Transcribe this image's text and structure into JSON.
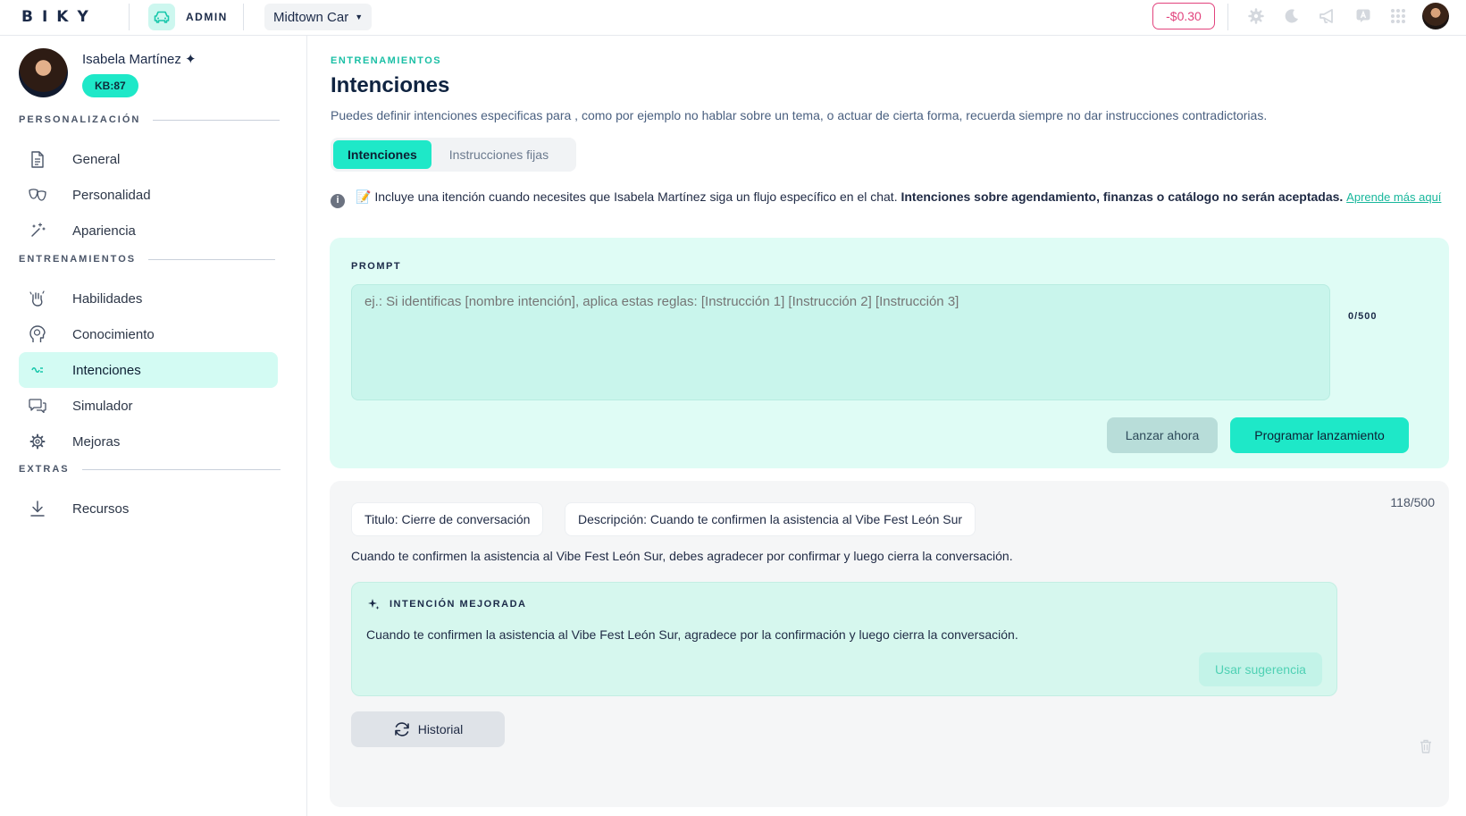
{
  "topbar": {
    "logo": "BIKY",
    "admin_label": "ADMIN",
    "company": "Midtown Car",
    "balance": "-$0.30"
  },
  "profile": {
    "name": "Isabela Martínez ✦",
    "kb_badge": "KB:87"
  },
  "sidebar": {
    "sections": [
      {
        "label": "PERSONALIZACIÓN"
      },
      {
        "label": "ENTRENAMIENTOS"
      },
      {
        "label": "EXTRAS"
      }
    ],
    "items": [
      {
        "label": "General"
      },
      {
        "label": "Personalidad"
      },
      {
        "label": "Apariencia"
      },
      {
        "label": "Habilidades"
      },
      {
        "label": "Conocimiento"
      },
      {
        "label": "Intenciones"
      },
      {
        "label": "Simulador"
      },
      {
        "label": "Mejoras"
      },
      {
        "label": "Recursos"
      }
    ],
    "active_item": "Intenciones"
  },
  "main": {
    "eyebrow": "ENTRENAMIENTOS",
    "title": "Intenciones",
    "subtitle": "Puedes definir intenciones especificas para , como por ejemplo no hablar sobre un tema, o actuar de cierta forma, recuerda siempre no dar instrucciones contradictorias.",
    "tabs": [
      {
        "label": "Intenciones",
        "active": true
      },
      {
        "label": "Instrucciones fijas",
        "active": false
      }
    ],
    "info": {
      "text": "📝 Incluye una itención cuando necesites que Isabela Martínez siga un flujo específico en el chat.",
      "bold": "Intenciones sobre agendamiento, finanzas o catálogo no serán aceptadas.",
      "link": "Aprende más aquí"
    },
    "prompt": {
      "label": "PROMPT",
      "placeholder": "ej.: Si identificas [nombre intención], aplica estas reglas: [Instrucción 1] [Instrucción 2] [Instrucción 3]",
      "value": "",
      "counter": "0/500",
      "launch_now": "Lanzar ahora",
      "schedule": "Programar lanzamiento"
    },
    "intent": {
      "count": "118/500",
      "title_chip": "Titulo: Cierre de conversación",
      "description_chip": "Descripción: Cuando te confirmen la asistencia al Vibe Fest León Sur",
      "text": "Cuando te confirmen la asistencia al Vibe Fest León Sur, debes agradecer por confirmar y luego cierra la conversación.",
      "improved_label": "INTENCIÓN MEJORADA",
      "improved_text": "Cuando te confirmen la asistencia al Vibe Fest León Sur, agradece por la confirmación y luego cierra la conversación.",
      "use_suggestion": "Usar sugerencia",
      "history": "Historial"
    }
  },
  "colors": {
    "accent": "#1ee8c8",
    "accent_soft": "#dffcf5",
    "balance": "#e2437d",
    "navy": "#0f2340"
  }
}
